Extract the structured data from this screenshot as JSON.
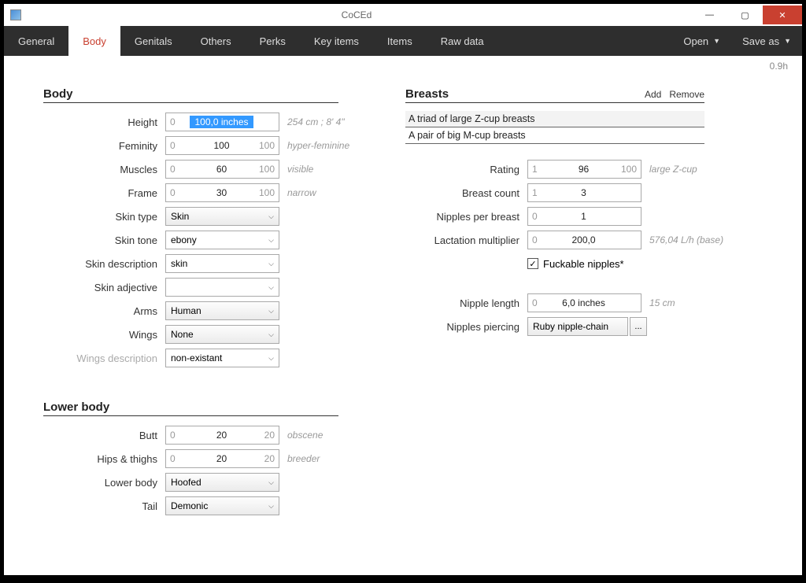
{
  "app": {
    "title": "CoCEd",
    "version": "0.9h"
  },
  "winbtns": {
    "min": "—",
    "max": "▢",
    "close": "✕"
  },
  "menu": {
    "tabs": [
      "General",
      "Body",
      "Genitals",
      "Others",
      "Perks",
      "Key items",
      "Items",
      "Raw data"
    ],
    "open": "Open",
    "saveas": "Save as"
  },
  "body": {
    "title": "Body",
    "height": {
      "label": "Height",
      "min": "0",
      "val": "100,0 inches",
      "max": "",
      "hint": "254 cm ; 8' 4\""
    },
    "feminity": {
      "label": "Feminity",
      "min": "0",
      "val": "100",
      "max": "100",
      "hint": "hyper-feminine"
    },
    "muscles": {
      "label": "Muscles",
      "min": "0",
      "val": "60",
      "max": "100",
      "hint": "visible"
    },
    "frame": {
      "label": "Frame",
      "min": "0",
      "val": "30",
      "max": "100",
      "hint": "narrow"
    },
    "skin_type": {
      "label": "Skin type",
      "val": "Skin"
    },
    "skin_tone": {
      "label": "Skin tone",
      "val": "ebony"
    },
    "skin_desc": {
      "label": "Skin description",
      "val": "skin"
    },
    "skin_adj": {
      "label": "Skin adjective",
      "val": ""
    },
    "arms": {
      "label": "Arms",
      "val": "Human"
    },
    "wings": {
      "label": "Wings",
      "val": "None"
    },
    "wings_desc": {
      "label": "Wings description",
      "val": "non-existant"
    }
  },
  "lower": {
    "title": "Lower body",
    "butt": {
      "label": "Butt",
      "min": "0",
      "val": "20",
      "max": "20",
      "hint": "obscene"
    },
    "hips": {
      "label": "Hips & thighs",
      "min": "0",
      "val": "20",
      "max": "20",
      "hint": "breeder"
    },
    "lower_body": {
      "label": "Lower body",
      "val": "Hoofed"
    },
    "tail": {
      "label": "Tail",
      "val": "Demonic"
    }
  },
  "breasts": {
    "title": "Breasts",
    "add": "Add",
    "remove": "Remove",
    "items": [
      "A triad of large Z-cup breasts",
      "A pair of big M-cup breasts"
    ],
    "rating": {
      "label": "Rating",
      "min": "1",
      "val": "96",
      "max": "100",
      "hint": "large Z-cup"
    },
    "count": {
      "label": "Breast count",
      "min": "1",
      "val": "3",
      "max": ""
    },
    "npb": {
      "label": "Nipples per breast",
      "min": "0",
      "val": "1",
      "max": ""
    },
    "lact": {
      "label": "Lactation multiplier",
      "min": "0",
      "val": "200,0",
      "max": "",
      "hint": "576,04 L/h (base)"
    },
    "fuckable": {
      "label": "Fuckable nipples*",
      "checked": true
    },
    "nip_len": {
      "label": "Nipple length",
      "min": "0",
      "val": "6,0 inches",
      "max": "",
      "hint": "15 cm"
    },
    "nip_pierce": {
      "label": "Nipples piercing",
      "val": "Ruby nipple-chain"
    },
    "more": "..."
  }
}
